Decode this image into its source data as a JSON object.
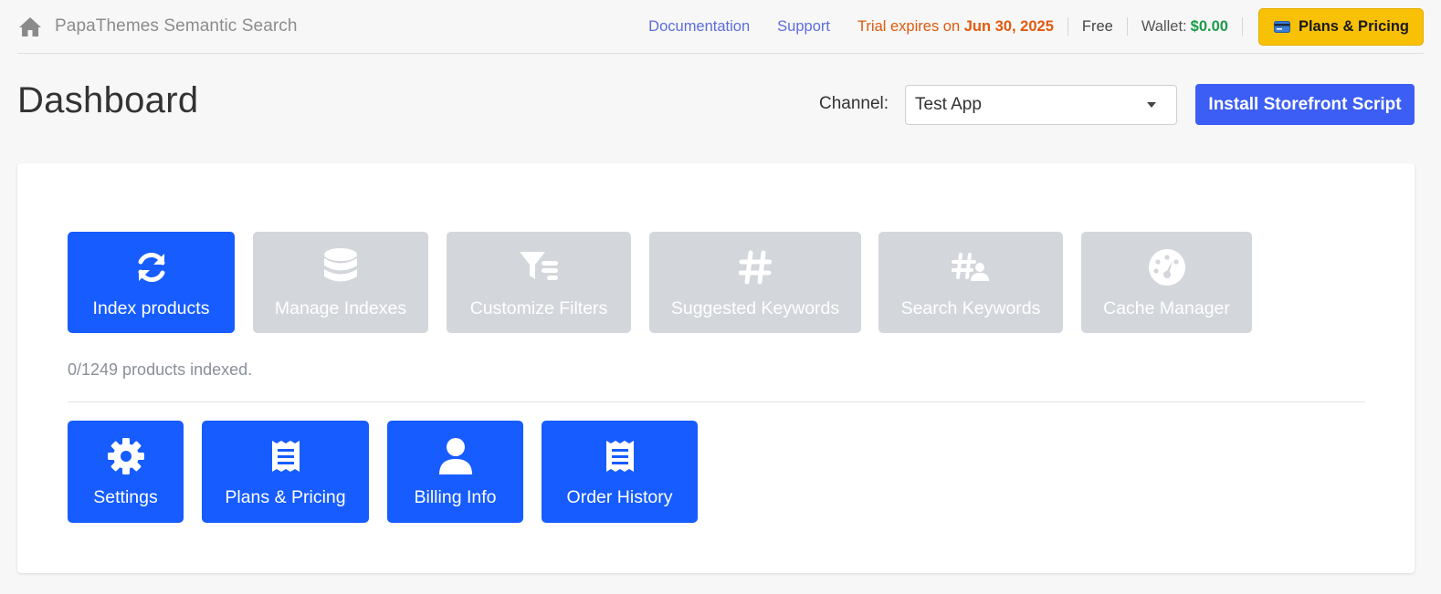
{
  "topbar": {
    "home_icon": "home-icon",
    "app_title": "PapaThemes Semantic Search",
    "docs_label": "Documentation",
    "support_label": "Support",
    "trial_prefix": "Trial expires on",
    "trial_date": "Jun 30, 2025",
    "plan": "Free",
    "wallet_label": "Wallet:",
    "wallet_amount": "$0.00",
    "pricing_button": "Plans & Pricing",
    "pricing_icon": "credit-card-icon"
  },
  "header": {
    "title": "Dashboard",
    "channel_label": "Channel:",
    "channel_value": "Test App",
    "install_button": "Install Storefront Script"
  },
  "tiles": [
    {
      "label": "Index products",
      "icon": "sync-icon",
      "state": "active"
    },
    {
      "label": "Manage Indexes",
      "icon": "database-icon",
      "state": "disabled"
    },
    {
      "label": "Customize Filters",
      "icon": "filter-list-icon",
      "state": "disabled"
    },
    {
      "label": "Suggested Keywords",
      "icon": "hashtag-icon",
      "state": "disabled"
    },
    {
      "label": "Search Keywords",
      "icon": "hashtag-user-icon",
      "state": "disabled"
    },
    {
      "label": "Cache Manager",
      "icon": "gauge-icon",
      "state": "disabled"
    }
  ],
  "index_status": "0/1249 products indexed.",
  "bottom_tiles": [
    {
      "label": "Settings",
      "icon": "gear-icon"
    },
    {
      "label": "Plans & Pricing",
      "icon": "receipt-icon"
    },
    {
      "label": "Billing Info",
      "icon": "user-icon"
    },
    {
      "label": "Order History",
      "icon": "receipt-icon"
    }
  ],
  "colors": {
    "primary": "#165cff",
    "install": "#3c5ef4",
    "disabled": "#d3d6db",
    "trial": "#e05a0e",
    "wallet": "#1c9a49",
    "pricing": "#f9c106",
    "link": "#5c6ddd"
  }
}
